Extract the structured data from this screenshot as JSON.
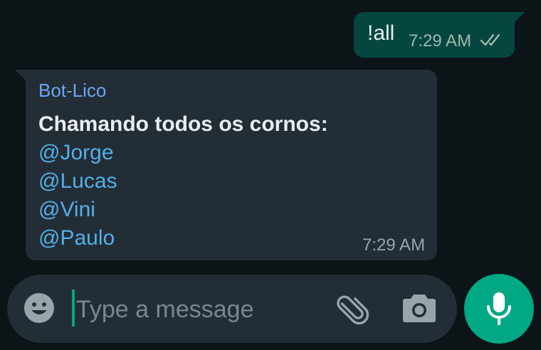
{
  "messages": {
    "outgoing": {
      "text": "!all",
      "time": "7:29 AM",
      "status_icon": "double-check-icon"
    },
    "incoming": {
      "sender": "Bot-Lico",
      "text_bold": "Chamando todos os cornos:",
      "mentions": [
        "@Jorge",
        "@Lucas",
        "@Vini",
        "@Paulo"
      ],
      "time": "7:29 AM"
    }
  },
  "composer": {
    "placeholder": "Type a message",
    "emoji_icon": "emoji-icon",
    "attach_icon": "paperclip-icon",
    "camera_icon": "camera-icon",
    "mic_icon": "microphone-icon"
  },
  "colors": {
    "background": "#0d1418",
    "outgoing_bubble": "#054740",
    "incoming_bubble": "#232d36",
    "sender_name": "#6ba6f0",
    "mention": "#53b0e8",
    "accent": "#00a884"
  }
}
